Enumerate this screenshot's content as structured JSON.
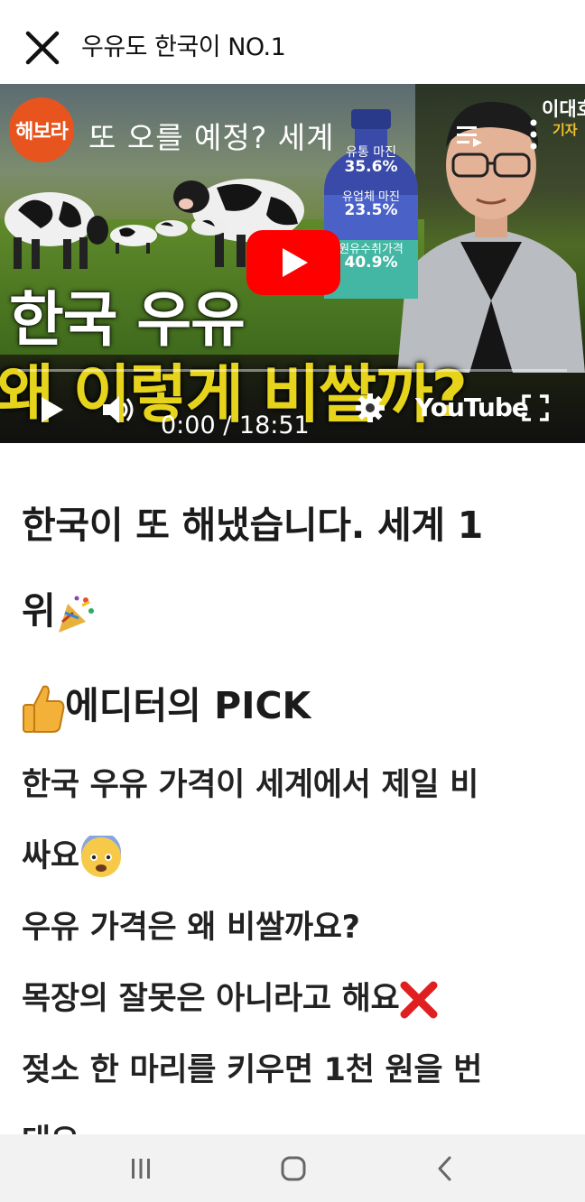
{
  "header": {
    "close_icon": "close-icon",
    "title": "우유도 한국이 NO.1"
  },
  "video": {
    "channel_badge": "해보라",
    "title": "또 오를 예정? 세계",
    "corner_name": "이대호",
    "corner_sub": "기자",
    "bottle_rows": [
      {
        "label": "유통 마진",
        "value": "35.6%"
      },
      {
        "label": "유업체 마진",
        "value": "23.5%"
      },
      {
        "label": "원유수취가격",
        "value": "40.9%"
      }
    ],
    "headline_line1": "한국 우유",
    "headline_line2": "왜 이렇게 비쌀까?",
    "time": "0:00 / 18:51",
    "brand": "YouTube",
    "progress": 0
  },
  "article": {
    "title_line1": "한국이 또 해냈습니다. 세계 1",
    "title_line2": "위",
    "pick_heading": "에디터의 PICK",
    "p1_line1": "한국 우유 가격이 세계에서 제일 비",
    "p1_line2": "싸요",
    "p2": "우유 가격은 왜 비쌀까요?",
    "p3": "목장의 잘못은 아니라고 해요",
    "p4_line1": "젖소 한 마리를 키우면 1천 원을 번",
    "p4_line2": "대요"
  },
  "navbar": {
    "recent_icon": "recent-apps-icon",
    "home_icon": "home-icon",
    "back_icon": "back-icon"
  }
}
